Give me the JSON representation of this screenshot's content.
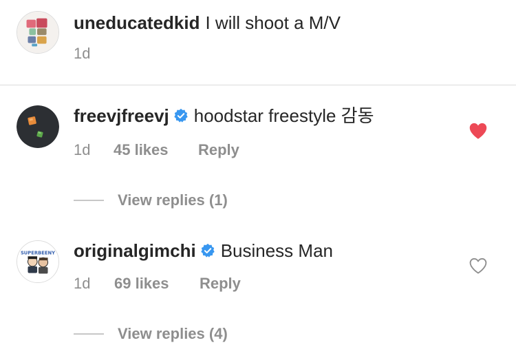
{
  "comments": [
    {
      "username": "uneducatedkid",
      "text": "I will shoot a M/V",
      "time": "1d",
      "avatar_icon": "cartoon-collage-avatar"
    },
    {
      "username": "freevjfreevj",
      "verified": true,
      "text": "hoodstar freestyle  감동",
      "time": "1d",
      "likes": "45 likes",
      "reply_label": "Reply",
      "liked": true,
      "view_replies": "View replies (1)",
      "avatar_icon": "orange-green-cubes-avatar"
    },
    {
      "username": "originalgimchi",
      "verified": true,
      "text": "Business Man",
      "time": "1d",
      "likes": "69 likes",
      "reply_label": "Reply",
      "liked": false,
      "view_replies": "View replies (4)",
      "avatar_icon": "comic-characters-avatar",
      "avatar_text": "SUPERBEENY"
    }
  ],
  "colors": {
    "liked_heart": "#ed4956",
    "verified_badge": "#3897f0",
    "meta_text": "#8e8e8e"
  }
}
